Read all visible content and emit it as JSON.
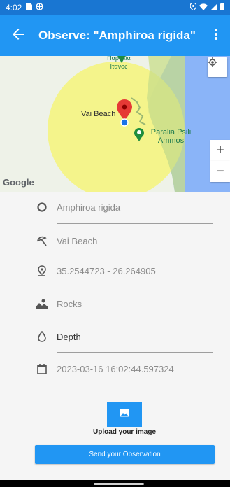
{
  "status_bar": {
    "time": "4:02",
    "icons": [
      "sim-card-icon",
      "notification-icon",
      "location-icon",
      "wifi-icon",
      "signal-icon",
      "battery-icon"
    ]
  },
  "app_bar": {
    "title": "Observe: \"Amphiroa rigida\"",
    "back_icon": "arrow-back-icon",
    "menu_icon": "more-vert-icon"
  },
  "map": {
    "labels": {
      "beach_greek": "Παραλία\nΙτανος",
      "vai_beach": "Vai Beach",
      "psili_ammos": "Paralia Psili\nAmmos"
    },
    "attribution": "Google",
    "colors": {
      "sea": "#8ab4f8",
      "land": "#d7e4b5",
      "radius_circle": "#f5f57a",
      "pin": "#e53935",
      "dot": "#1a73e8"
    },
    "zoom_in": "+",
    "zoom_out": "−"
  },
  "form": {
    "species": "Amphiroa rigida",
    "location": "Vai Beach",
    "coordinates": "35.2544723 - 26.264905",
    "substrate": "Rocks",
    "depth_placeholder": "Depth",
    "timestamp": "2023-03-16 16:02:44.597324",
    "upload_label": "Upload your image",
    "send_label": "Send your Observation"
  },
  "colors": {
    "primary": "#2196F3",
    "status": "#1976D2"
  }
}
